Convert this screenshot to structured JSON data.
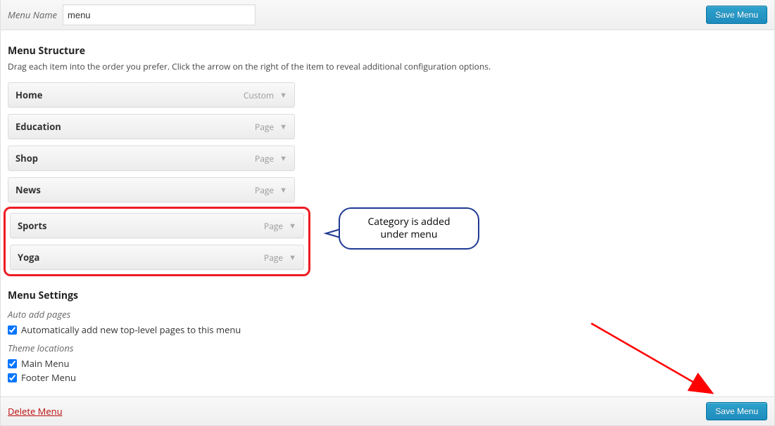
{
  "header": {
    "menu_name_label": "Menu Name",
    "menu_name_value": "menu",
    "save_label": "Save Menu"
  },
  "structure": {
    "title": "Menu Structure",
    "desc": "Drag each item into the order you prefer. Click the arrow on the right of the item to reveal additional configuration options."
  },
  "items": [
    {
      "title": "Home",
      "type": "Custom"
    },
    {
      "title": "Education",
      "type": "Page"
    },
    {
      "title": "Shop",
      "type": "Page"
    },
    {
      "title": "News",
      "type": "Page"
    },
    {
      "title": "Sports",
      "type": "Page"
    },
    {
      "title": "Yoga",
      "type": "Page"
    }
  ],
  "settings": {
    "title": "Menu Settings",
    "auto_add_label": "Auto add pages",
    "auto_add_check": "Automatically add new top-level pages to this menu",
    "theme_loc_label": "Theme locations",
    "loc1": "Main Menu",
    "loc2": "Footer Menu"
  },
  "footer": {
    "delete_label": "Delete Menu",
    "save_label": "Save Menu"
  },
  "annotation": {
    "callout_line1": "Category is added",
    "callout_line2": "under menu"
  }
}
